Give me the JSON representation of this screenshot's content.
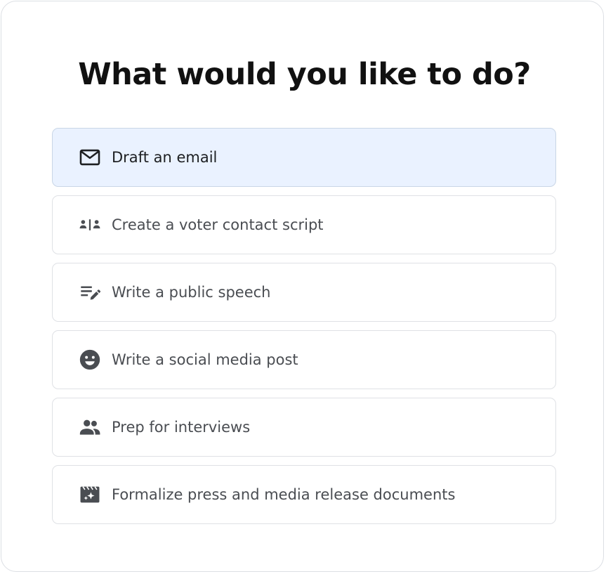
{
  "heading": "What would you like to do?",
  "options": [
    {
      "label": "Draft an email",
      "icon": "mail-icon",
      "selected": true
    },
    {
      "label": "Create a voter contact script",
      "icon": "contact-script-icon",
      "selected": false
    },
    {
      "label": "Write a public speech",
      "icon": "edit-notes-icon",
      "selected": false
    },
    {
      "label": "Write a social media post",
      "icon": "smiley-face-icon",
      "selected": false
    },
    {
      "label": "Prep for interviews",
      "icon": "people-icon",
      "selected": false
    },
    {
      "label": "Formalize press and media release documents",
      "icon": "media-clapperboard-icon",
      "selected": false
    }
  ],
  "colors": {
    "selected_background": "#eaf2ff",
    "icon_color": "#4a4d52",
    "selected_icon_color": "#1d1f22"
  }
}
